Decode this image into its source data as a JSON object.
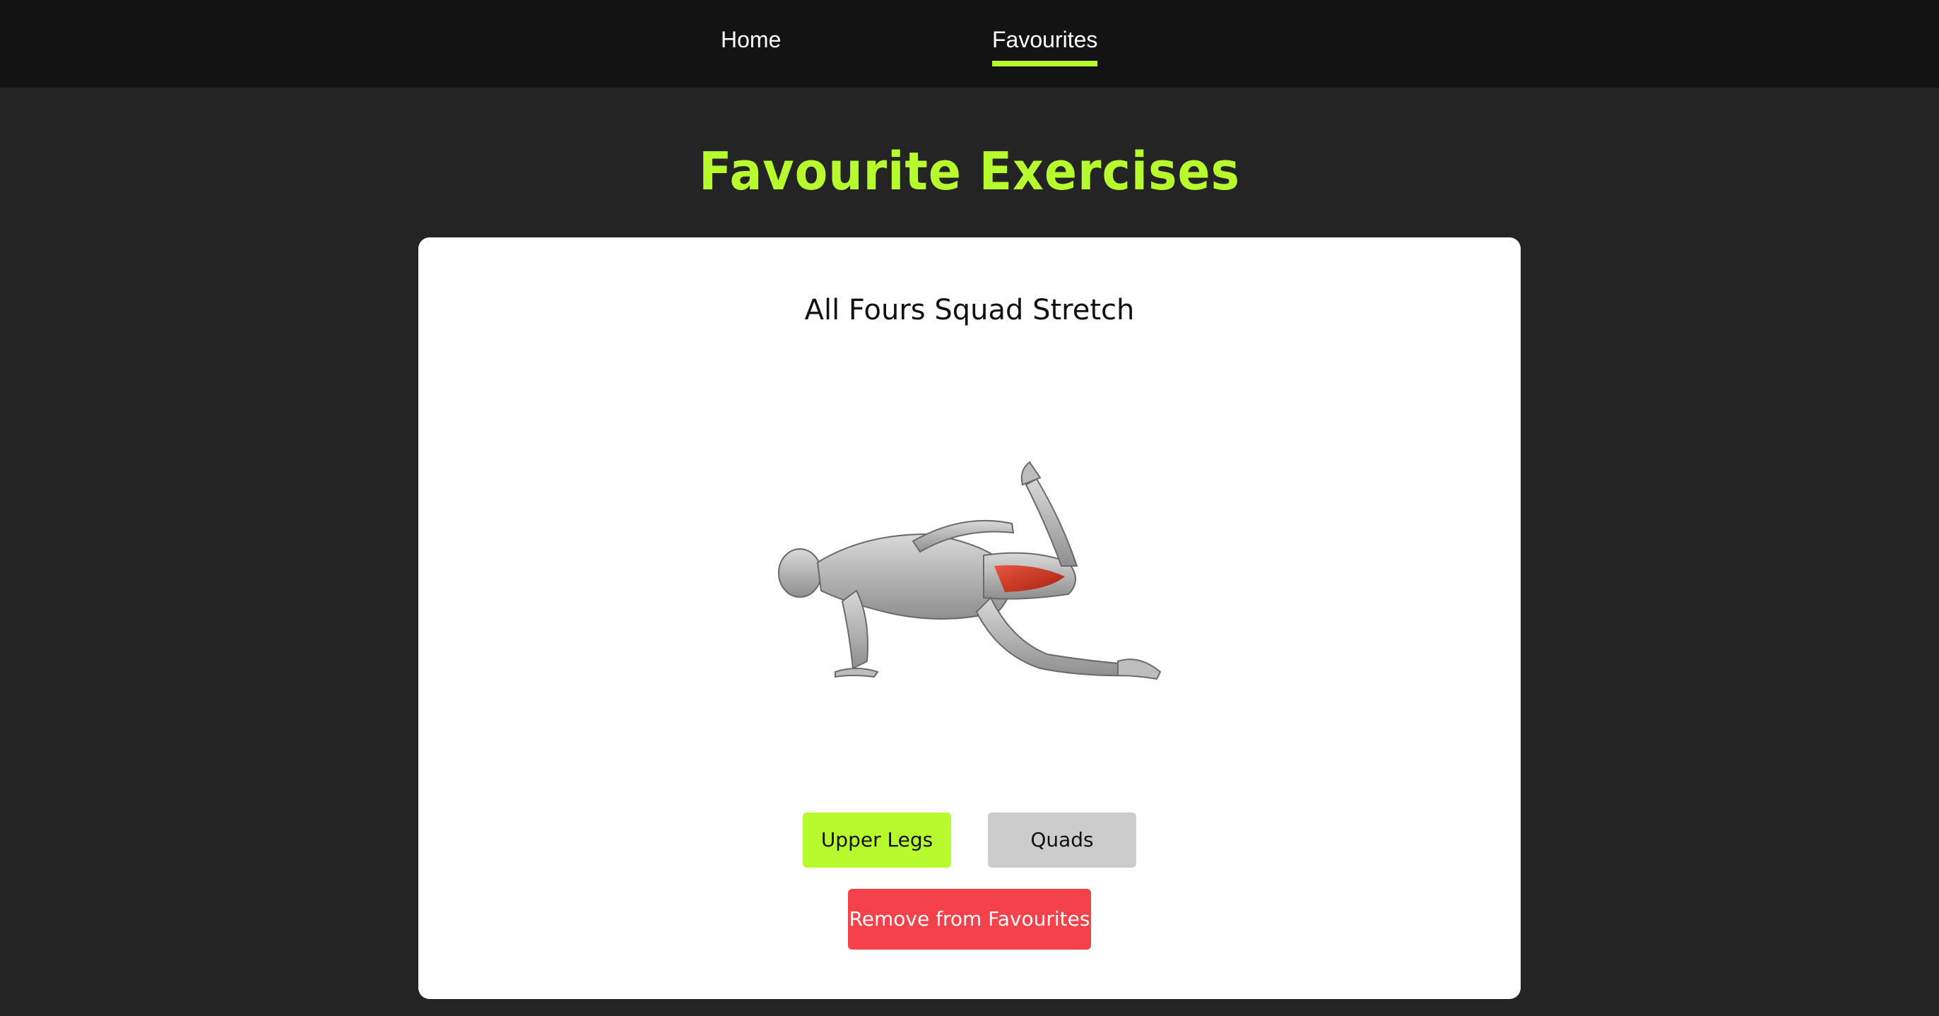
{
  "nav": {
    "home_label": "Home",
    "favourites_label": "Favourites",
    "accent_color": "#b7fb2e"
  },
  "page": {
    "title": "Favourite Exercises"
  },
  "card": {
    "exercise_name": "All Fours Squad Stretch",
    "figure_icon": "kneeling-quad-stretch-anatomy-illustration",
    "body_part_tag": "Upper Legs",
    "target_tag": "Quads",
    "remove_label": "Remove from Favourites",
    "colors": {
      "body_part_tag": "#b7fb2e",
      "target_tag": "#cccccc",
      "remove_button": "#f5424a"
    }
  }
}
